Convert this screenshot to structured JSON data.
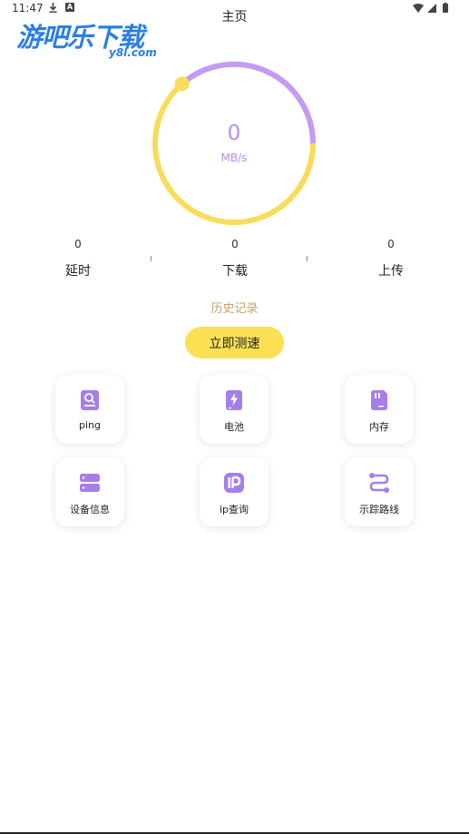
{
  "status_bar": {
    "time": "11:47",
    "download_icon": "download-icon",
    "notification_icon": "A",
    "wifi_icon": "wifi-icon",
    "signal_icon": "signal-icon",
    "battery_icon": "battery-icon"
  },
  "watermark": {
    "main": "游吧乐下载",
    "sub": "y8l.com"
  },
  "header": {
    "title": "主页"
  },
  "gauge": {
    "value": "0",
    "unit": "MB/s",
    "colors": {
      "track": "#f8dc5a",
      "progress": "#c39af5",
      "knob": "#f8dc5a"
    }
  },
  "stats": [
    {
      "value": "0",
      "label": "延时"
    },
    {
      "value": "0",
      "label": "下载"
    },
    {
      "value": "0",
      "label": "上传"
    }
  ],
  "history": {
    "label": "历史记录"
  },
  "actions": {
    "test_button": "立即测速"
  },
  "tools": [
    {
      "label": "ping",
      "icon": "ping-icon"
    },
    {
      "label": "电池",
      "icon": "battery-charge-icon"
    },
    {
      "label": "内存",
      "icon": "sd-card-icon"
    },
    {
      "label": "设备信息",
      "icon": "server-icon"
    },
    {
      "label": "ip查询",
      "icon": "ip-icon"
    },
    {
      "label": "示踪路线",
      "icon": "route-icon"
    }
  ],
  "theme": {
    "accent": "#fbe054",
    "icon_purple": "#a67ee8",
    "history_text": "#c6a16a"
  }
}
